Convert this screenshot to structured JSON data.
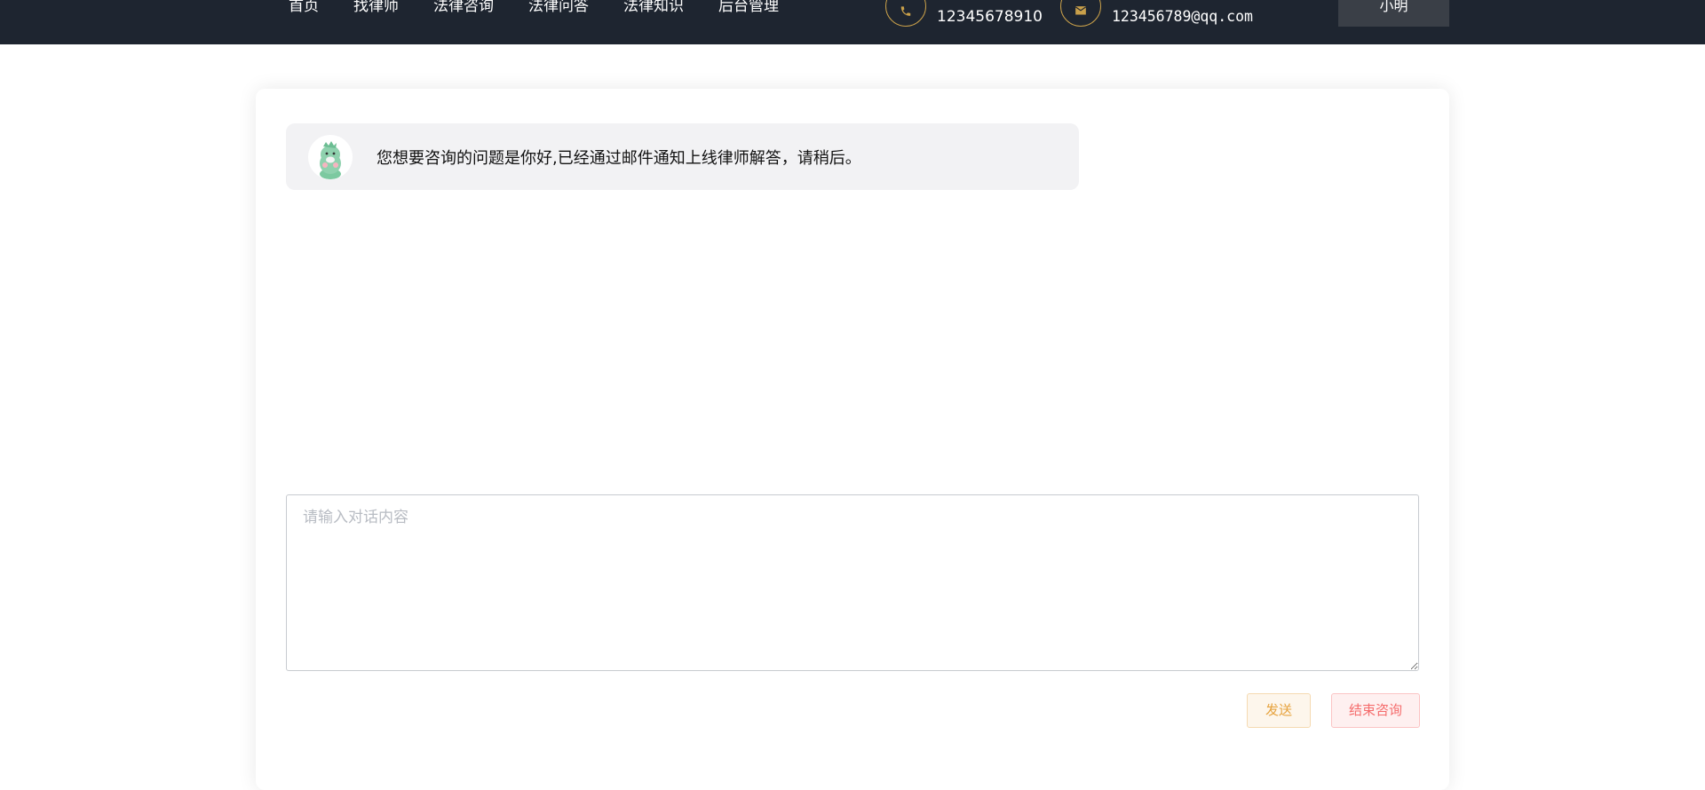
{
  "nav": {
    "items": [
      "首页",
      "找律师",
      "法律咨询",
      "法律问答",
      "法律知识",
      "后台管理"
    ]
  },
  "contact": {
    "phone": "12345678910",
    "email": "123456789@qq.com",
    "phone_icon": "phone-icon",
    "email_icon": "mail-icon"
  },
  "user": {
    "name": "小明"
  },
  "chat": {
    "messages": [
      {
        "avatar_icon": "dinosaur-avatar",
        "text": "您想要咨询的问题是你好,已经通过邮件通知上线律师解答，请稍后。"
      }
    ],
    "input_placeholder": "请输入对话内容",
    "input_value": "",
    "send_label": "发送",
    "end_label": "结束咨询"
  },
  "colors": {
    "topbar": "#1e2530",
    "accent_gold": "#c9a04a",
    "warning": "#e6a23c",
    "danger": "#f56c6c"
  }
}
